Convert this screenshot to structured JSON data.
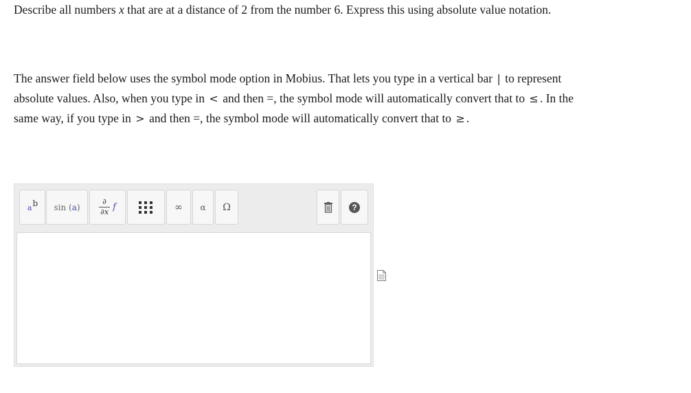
{
  "question": {
    "q_pre": "Describe all numbers ",
    "q_var": "x",
    "q_mid": " that are at a distance of 2 from the number 6. Express this using absolute value notation."
  },
  "instructions": {
    "p1": "The answer field below uses the symbol mode option in Mobius. That lets you type in a vertical bar ",
    "bar_symbol": "|",
    "p2": " to represent absolute values. Also, when you type in ",
    "lt_symbol": "<",
    "p3": " and then =, the symbol mode will automatically convert that to ",
    "le_symbol": "≤",
    "p4": ". In the same way, if you type in ",
    "gt_symbol": ">",
    "p5": " and then =, the symbol mode will automatically convert that to ",
    "ge_symbol": "≥",
    "p6": "."
  },
  "toolbar": {
    "superscript": {
      "base": "a",
      "exp": "b"
    },
    "sin": {
      "fn": "sin",
      "arg": "a"
    },
    "derivative": {
      "num": "∂",
      "den": "∂x",
      "f": "f"
    },
    "infinity": "∞",
    "alpha": "α",
    "omega": "Ω",
    "help": "?"
  },
  "icons": {
    "superscript": "superscript-icon",
    "sin": "sin-icon",
    "derivative": "partial-derivative-icon",
    "matrix": "matrix-icon",
    "trash": "trash-icon",
    "help": "help-icon",
    "document": "document-icon"
  }
}
